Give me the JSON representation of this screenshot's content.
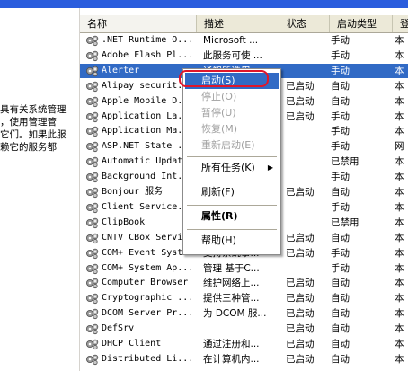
{
  "left_pane": {
    "lines": [
      "具有关系统管理",
      "，使用管理管",
      "它们。如果此服",
      "赖它的服务都"
    ]
  },
  "columns": {
    "name": "名称",
    "description": "描述",
    "status": "状态",
    "startup_type": "启动类型",
    "logon_as": "登"
  },
  "services": [
    {
      "name": ".NET Runtime O...",
      "description": "Microsoft ...",
      "status": "",
      "startup": "手动",
      "logon": "本"
    },
    {
      "name": "Adobe Flash Pl...",
      "description": "此服务可使 ...",
      "status": "",
      "startup": "手动",
      "logon": "本"
    },
    {
      "name": "Alerter",
      "description": "通知所选用...",
      "status": "",
      "startup": "手动",
      "logon": "本"
    },
    {
      "name": "Alipay securit...",
      "description": "",
      "status": "已启动",
      "startup": "自动",
      "logon": "本"
    },
    {
      "name": "Apple Mobile D...",
      "description": "",
      "status": "已启动",
      "startup": "自动",
      "logon": "本"
    },
    {
      "name": "Application La...",
      "description": "",
      "status": "已启动",
      "startup": "手动",
      "logon": "本"
    },
    {
      "name": "Application Ma...",
      "description": "",
      "status": "",
      "startup": "手动",
      "logon": "本"
    },
    {
      "name": "ASP.NET State ...",
      "description": "",
      "status": "",
      "startup": "手动",
      "logon": "网"
    },
    {
      "name": "Automatic Updat...",
      "description": "",
      "status": "",
      "startup": "已禁用",
      "logon": "本"
    },
    {
      "name": "Background Int...",
      "description": "",
      "status": "",
      "startup": "手动",
      "logon": "本"
    },
    {
      "name": "Bonjour 服务",
      "description": "",
      "status": "已启动",
      "startup": "自动",
      "logon": "本"
    },
    {
      "name": "Client Service...",
      "description": "",
      "status": "",
      "startup": "手动",
      "logon": "本"
    },
    {
      "name": "ClipBook",
      "description": "",
      "status": "",
      "startup": "已禁用",
      "logon": "本"
    },
    {
      "name": "CNTV CBox Servi...",
      "description": "",
      "status": "已启动",
      "startup": "自动",
      "logon": "本"
    },
    {
      "name": "COM+ Event System",
      "description": "支持系统事...",
      "status": "已启动",
      "startup": "手动",
      "logon": "本"
    },
    {
      "name": "COM+ System Ap...",
      "description": "管理 基于C...",
      "status": "",
      "startup": "手动",
      "logon": "本"
    },
    {
      "name": "Computer Browser",
      "description": "维护网络上...",
      "status": "已启动",
      "startup": "自动",
      "logon": "本"
    },
    {
      "name": "Cryptographic ...",
      "description": "提供三种管...",
      "status": "已启动",
      "startup": "自动",
      "logon": "本"
    },
    {
      "name": "DCOM Server Pr...",
      "description": "为 DCOM 服...",
      "status": "已启动",
      "startup": "自动",
      "logon": "本"
    },
    {
      "name": "DefSrv",
      "description": "",
      "status": "已启动",
      "startup": "自动",
      "logon": "本"
    },
    {
      "name": "DHCP Client",
      "description": "通过注册和...",
      "status": "已启动",
      "startup": "自动",
      "logon": "本"
    },
    {
      "name": "Distributed Li...",
      "description": "在计算机内...",
      "status": "已启动",
      "startup": "自动",
      "logon": "本"
    }
  ],
  "selected_index": 2,
  "context_menu": {
    "items": [
      {
        "label": "启动(S)",
        "state": "highlighted"
      },
      {
        "label": "停止(O)",
        "state": "disabled"
      },
      {
        "label": "暂停(U)",
        "state": "disabled"
      },
      {
        "label": "恢复(M)",
        "state": "disabled"
      },
      {
        "label": "重新启动(E)",
        "state": "disabled"
      },
      {
        "label": "所有任务(K)",
        "state": "submenu"
      },
      {
        "label": "刷新(F)",
        "state": "normal"
      },
      {
        "label": "属性(R)",
        "state": "bold"
      },
      {
        "label": "帮助(H)",
        "state": "normal"
      }
    ],
    "submenu_arrow": "▶"
  },
  "colors": {
    "title_bar": "#2a5ddd",
    "selection": "#316ac5",
    "annotation_ring": "#e0162b"
  },
  "icons": {
    "service": "gear-icon"
  }
}
